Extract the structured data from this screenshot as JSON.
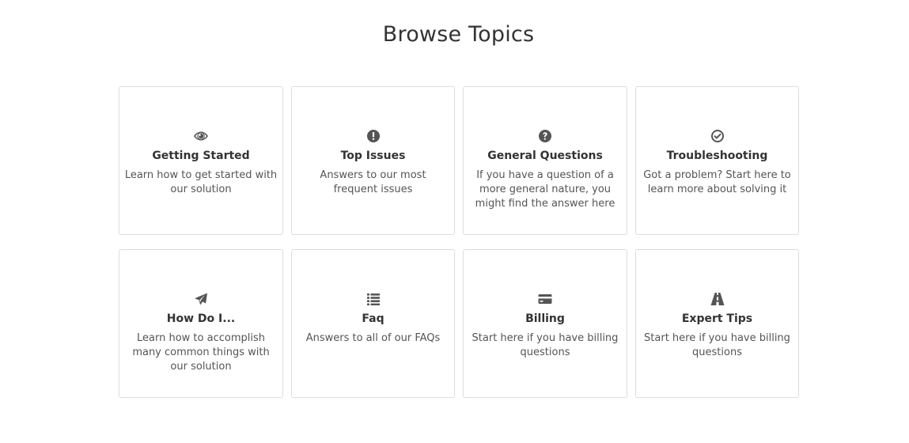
{
  "page": {
    "title": "Browse Topics"
  },
  "topics": [
    {
      "title": "Getting Started",
      "description": "Learn how to get started with our solution",
      "icon": "eye-icon"
    },
    {
      "title": "Top Issues",
      "description": "Answers to our most frequent issues",
      "icon": "exclamation-circle-icon"
    },
    {
      "title": "General Questions",
      "description": "If you have a question of a more general nature, you might find the answer here",
      "icon": "question-circle-icon"
    },
    {
      "title": "Troubleshooting",
      "description": "Got a problem? Start here to learn more about solving it",
      "icon": "check-circle-icon"
    },
    {
      "title": "How Do I...",
      "description": "Learn how to accomplish many common things with our solution",
      "icon": "paper-plane-icon"
    },
    {
      "title": "Faq",
      "description": "Answers to all of our FAQs",
      "icon": "list-icon"
    },
    {
      "title": "Billing",
      "description": "Start here if you have billing questions",
      "icon": "credit-card-icon"
    },
    {
      "title": "Expert Tips",
      "description": "Start here if you have billing questions",
      "icon": "road-icon"
    }
  ],
  "colors": {
    "text": "#333333",
    "muted": "#555555",
    "border": "#dddddd",
    "background": "#ffffff"
  }
}
